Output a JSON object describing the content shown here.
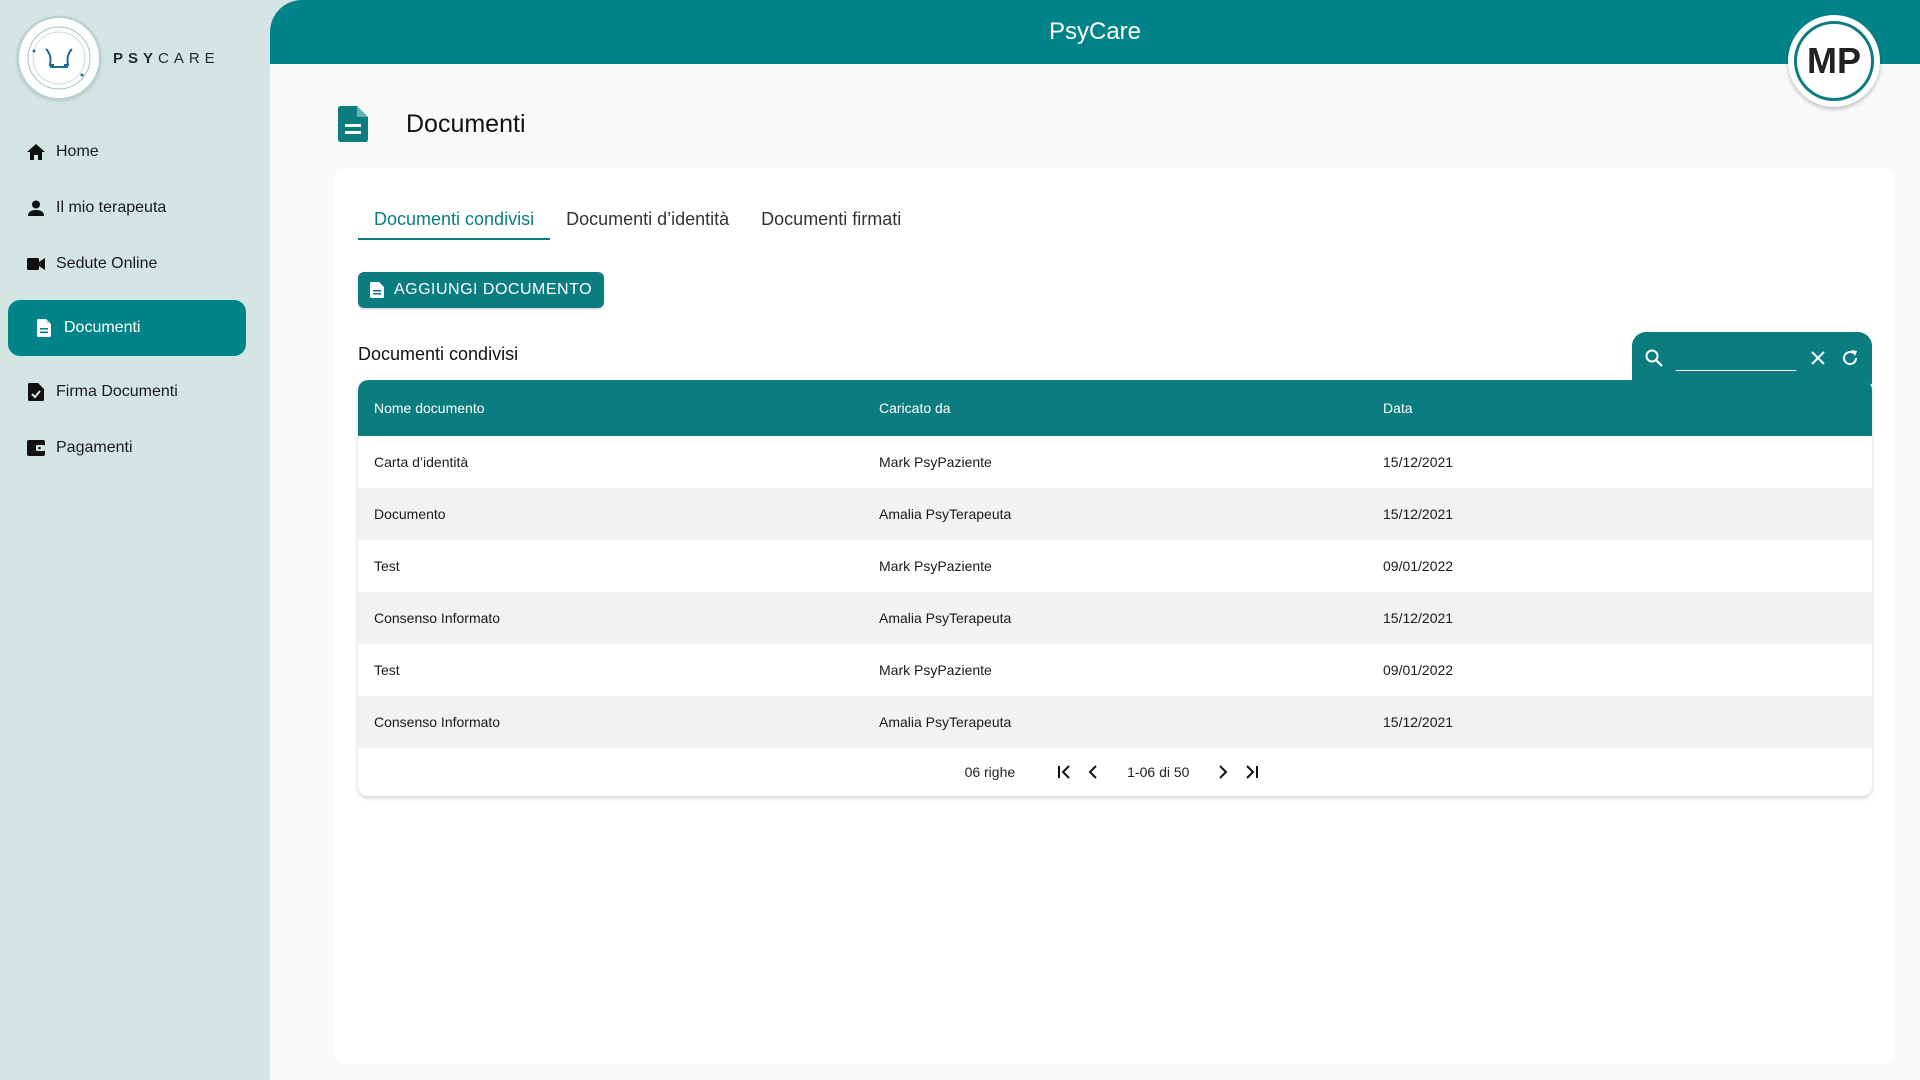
{
  "app": {
    "title": "PsyCare",
    "logo_prefix": "PSY",
    "logo_suffix": "CARE",
    "user_initials": "MP",
    "accent": "#008489"
  },
  "sidebar": {
    "items": [
      {
        "label": "Home",
        "icon": "home-icon"
      },
      {
        "label": "Il mio terapeuta",
        "icon": "person-icon"
      },
      {
        "label": "Sedute Online",
        "icon": "video-camera-icon"
      },
      {
        "label": "Documenti",
        "icon": "document-icon",
        "active": true
      },
      {
        "label": "Firma Documenti",
        "icon": "document-check-icon"
      },
      {
        "label": "Pagamenti",
        "icon": "wallet-icon"
      }
    ]
  },
  "page": {
    "title": "Documenti"
  },
  "tabs": [
    {
      "label": "Documenti condivisi",
      "active": true
    },
    {
      "label": "Documenti d’identità"
    },
    {
      "label": "Documenti firmati"
    }
  ],
  "actions": {
    "add_document": "AGGIUNGI DOCUMENTO"
  },
  "table": {
    "title": "Documenti condivisi",
    "search_value": "",
    "columns": [
      "Nome documento",
      "Caricato da",
      "Data"
    ],
    "rows": [
      [
        "Carta d’identità",
        "Mark PsyPaziente",
        "15/12/2021"
      ],
      [
        "Documento",
        "Amalia PsyTerapeuta",
        "15/12/2021"
      ],
      [
        "Test",
        "Mark PsyPaziente",
        "09/01/2022"
      ],
      [
        "Consenso Informato",
        "Amalia PsyTerapeuta",
        "15/12/2021"
      ],
      [
        "Test",
        "Mark PsyPaziente",
        "09/01/2022"
      ],
      [
        "Consenso Informato",
        "Amalia PsyTerapeuta",
        "15/12/2021"
      ]
    ],
    "pagination": {
      "rows_per_page": "06 righe",
      "range": "1-06 di 50"
    }
  }
}
